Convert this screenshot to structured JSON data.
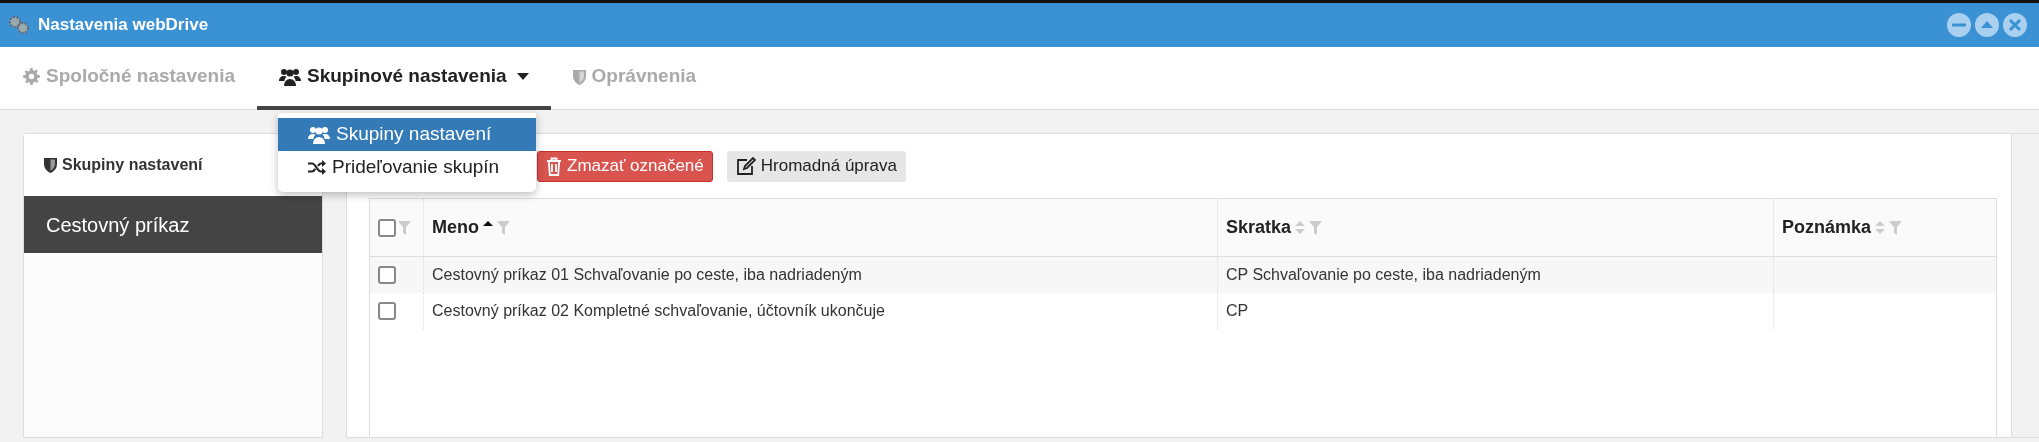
{
  "window": {
    "title": "Nastavenia webDrive",
    "controls": [
      {
        "kind": "minimize"
      },
      {
        "kind": "maximize"
      },
      {
        "kind": "close"
      }
    ]
  },
  "tabs": [
    {
      "label": "Spoločné nastavenia",
      "selected": false,
      "dropdown": false
    },
    {
      "label": "Skupinové nastavenia",
      "selected": true,
      "dropdown": true
    },
    {
      "label": "Oprávnenia",
      "selected": false,
      "dropdown": false
    }
  ],
  "dropdown_menu": [
    {
      "label": "Skupiny nastavení",
      "selected": true
    },
    {
      "label": "Prideľovanie skupín",
      "selected": false
    }
  ],
  "sidebar": {
    "title": "Skupiny nastavení",
    "items": [
      {
        "label": "Cestovný príkaz",
        "selected": true
      }
    ]
  },
  "toolbar": [
    {
      "label": "Zmazať označené",
      "kind": "danger"
    },
    {
      "label": "Hromadná úprava",
      "kind": "light"
    }
  ],
  "table": {
    "select_all_checked": false,
    "columns": [
      {
        "label": "Meno",
        "sorted": true
      },
      {
        "label": "Skratka",
        "sorted": false
      },
      {
        "label": "Poznámka",
        "sorted": false
      }
    ],
    "rows": [
      {
        "checked": false,
        "cells": [
          "Cestovný príkaz 01 Schvaľovanie po ceste, iba nadriadeným",
          "CP Schvaľovanie po ceste, iba nadriadeným",
          ""
        ]
      },
      {
        "checked": false,
        "cells": [
          "Cestovný príkaz 02 Kompletné schvaľovanie, účtovník ukončuje",
          "CP",
          ""
        ]
      }
    ]
  }
}
